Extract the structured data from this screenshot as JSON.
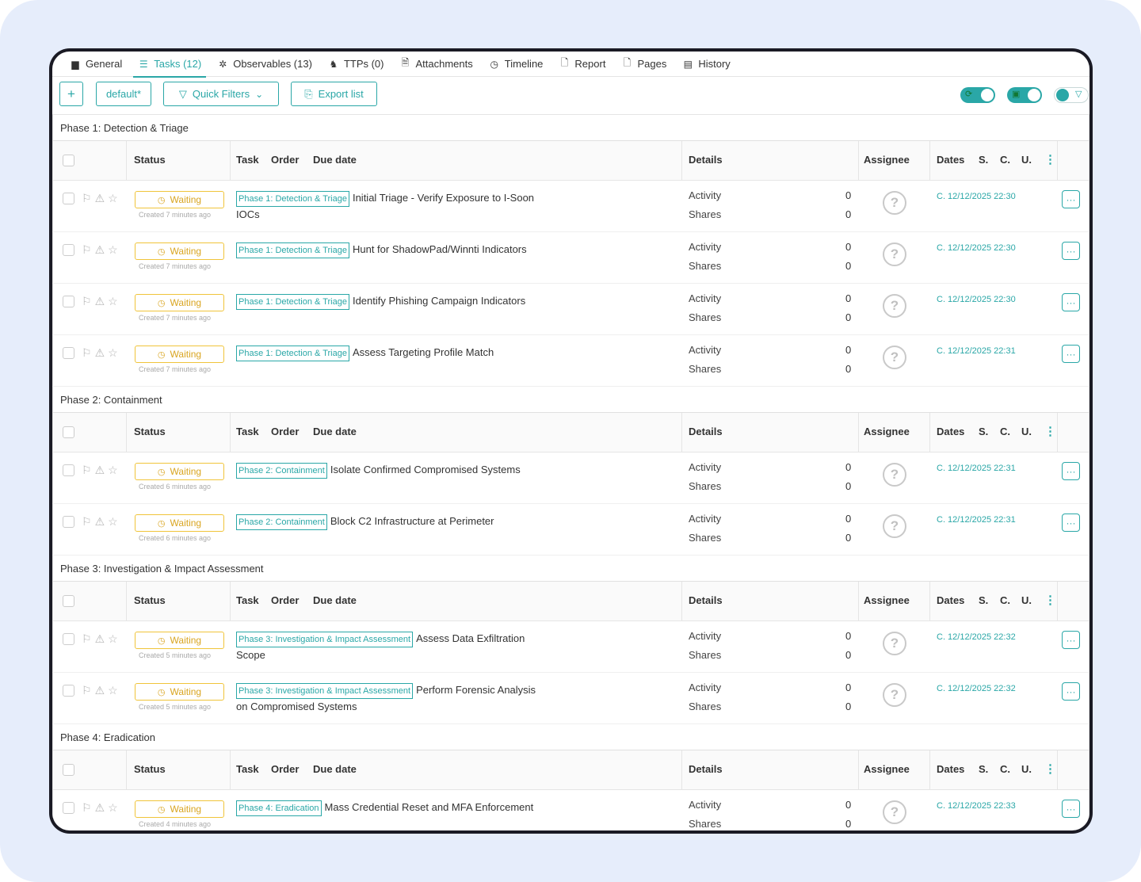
{
  "tabs": [
    {
      "label": "General",
      "icon": "briefcase-icon",
      "glyph": "▆"
    },
    {
      "label": "Tasks (12)",
      "icon": "tasks-icon",
      "glyph": "☰",
      "active": true
    },
    {
      "label": "Observables (13)",
      "icon": "bug-icon",
      "glyph": "✲"
    },
    {
      "label": "TTPs (0)",
      "icon": "chess-icon",
      "glyph": "♞"
    },
    {
      "label": "Attachments",
      "icon": "file-icon",
      "glyph": "🗎"
    },
    {
      "label": "Timeline",
      "icon": "clock-icon",
      "glyph": "◷"
    },
    {
      "label": "Report",
      "icon": "report-icon",
      "glyph": "🗋"
    },
    {
      "label": "Pages",
      "icon": "page-icon",
      "glyph": "🗋"
    },
    {
      "label": "History",
      "icon": "history-icon",
      "glyph": "▤"
    }
  ],
  "toolbar": {
    "add_label": "+",
    "filter_label": "default*",
    "quick_filters_label": "Quick Filters",
    "export_label": "Export list"
  },
  "columns": {
    "status": "Status",
    "task": "Task",
    "order": "Order",
    "due": "Due date",
    "details": "Details",
    "assignee": "Assignee",
    "dates": "Dates",
    "s": "S.",
    "c": "C.",
    "u": "U."
  },
  "labels": {
    "activity": "Activity",
    "shares": "Shares",
    "waiting": "Waiting"
  },
  "groups": [
    {
      "title": "Phase 1: Detection & Triage",
      "rows": [
        {
          "phase": "Phase 1: Detection & Triage",
          "title": "Initial Triage - Verify Exposure to I-Soon IOCs",
          "created": "Created 7 minutes ago",
          "activity": "0",
          "shares": "0",
          "date": "C. 12/12/2025 22:30"
        },
        {
          "phase": "Phase 1: Detection & Triage",
          "title": "Hunt for ShadowPad/Winnti Indicators",
          "created": "Created 7 minutes ago",
          "activity": "0",
          "shares": "0",
          "date": "C. 12/12/2025 22:30"
        },
        {
          "phase": "Phase 1: Detection & Triage",
          "title": "Identify Phishing Campaign Indicators",
          "created": "Created 7 minutes ago",
          "activity": "0",
          "shares": "0",
          "date": "C. 12/12/2025 22:30"
        },
        {
          "phase": "Phase 1: Detection & Triage",
          "title": "Assess Targeting Profile Match",
          "created": "Created 7 minutes ago",
          "activity": "0",
          "shares": "0",
          "date": "C. 12/12/2025 22:31"
        }
      ]
    },
    {
      "title": "Phase 2: Containment",
      "rows": [
        {
          "phase": "Phase 2: Containment",
          "title": "Isolate Confirmed Compromised Systems",
          "created": "Created 6 minutes ago",
          "activity": "0",
          "shares": "0",
          "date": "C. 12/12/2025 22:31"
        },
        {
          "phase": "Phase 2: Containment",
          "title": "Block C2 Infrastructure at Perimeter",
          "created": "Created 6 minutes ago",
          "activity": "0",
          "shares": "0",
          "date": "C. 12/12/2025 22:31"
        }
      ]
    },
    {
      "title": "Phase 3: Investigation & Impact Assessment",
      "rows": [
        {
          "phase": "Phase 3: Investigation & Impact Assessment",
          "title": "Assess Data Exfiltration Scope",
          "created": "Created 5 minutes ago",
          "activity": "0",
          "shares": "0",
          "date": "C. 12/12/2025 22:32"
        },
        {
          "phase": "Phase 3: Investigation & Impact Assessment",
          "title": "Perform Forensic Analysis on Compromised Systems",
          "created": "Created 5 minutes ago",
          "activity": "0",
          "shares": "0",
          "date": "C. 12/12/2025 22:32"
        }
      ]
    },
    {
      "title": "Phase 4: Eradication",
      "rows": [
        {
          "phase": "Phase 4: Eradication",
          "title": "Mass Credential Reset and MFA Enforcement",
          "created": "Created 4 minutes ago",
          "activity": "0",
          "shares": "0",
          "date": "C. 12/12/2025 22:33"
        }
      ]
    }
  ],
  "colors": {
    "accent": "#2aa7a7",
    "waiting": "#f0c43a",
    "frame": "#1a1a24",
    "background": "#e6edfb"
  }
}
